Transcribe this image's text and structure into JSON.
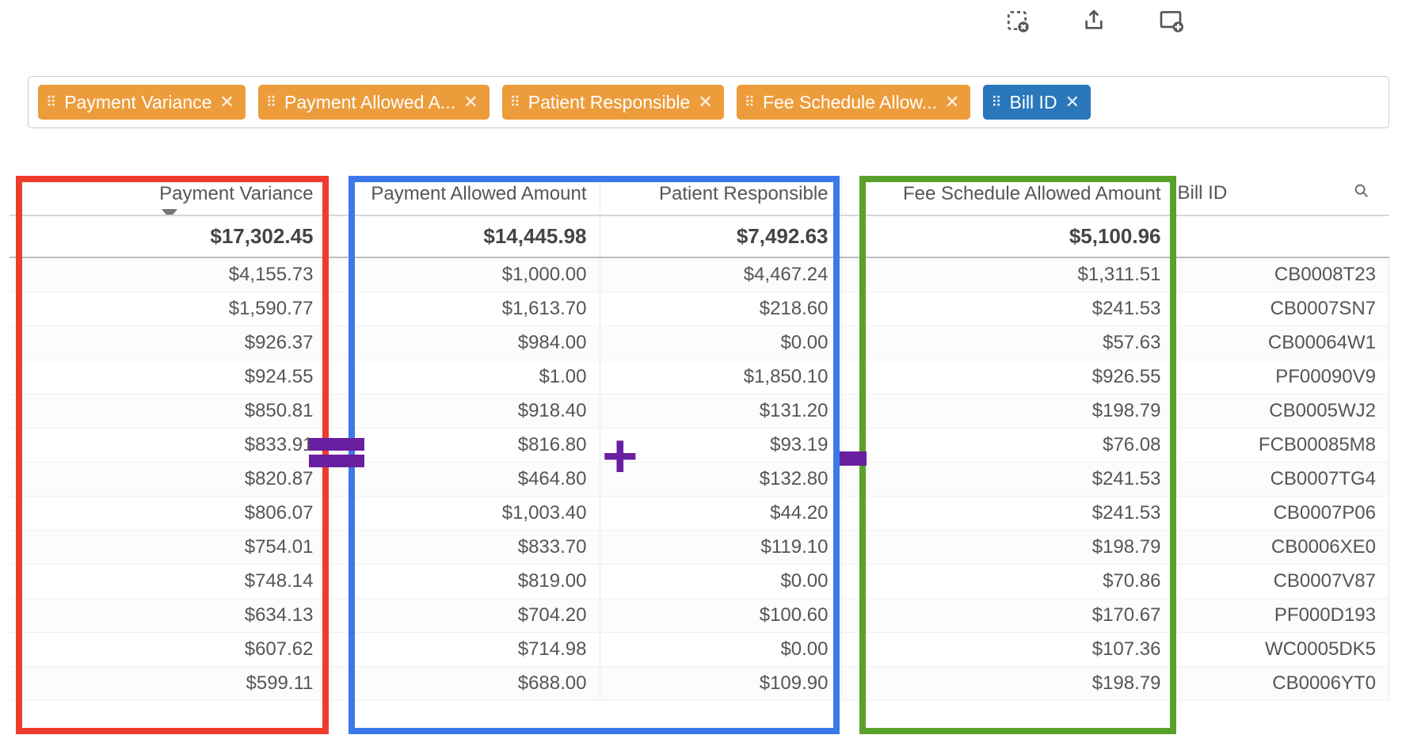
{
  "toolbar": {
    "icons": [
      "clear-selection-icon",
      "share-icon",
      "add-panel-icon"
    ]
  },
  "chips": [
    {
      "label": "Payment Variance",
      "color": "orange"
    },
    {
      "label": "Payment Allowed A...",
      "color": "orange"
    },
    {
      "label": "Patient Responsible",
      "color": "orange"
    },
    {
      "label": "Fee Schedule Allow...",
      "color": "orange"
    },
    {
      "label": "Bill ID",
      "color": "blue"
    }
  ],
  "columns": [
    {
      "header": "Payment Variance",
      "align": "right",
      "sort": "desc"
    },
    {
      "header": "Payment Allowed Amount",
      "align": "right"
    },
    {
      "header": "Patient Responsible",
      "align": "right"
    },
    {
      "header": "Fee Schedule Allowed Amount",
      "align": "right"
    },
    {
      "header": "Bill ID",
      "align": "left"
    }
  ],
  "totals": {
    "payment_variance": "$17,302.45",
    "payment_allowed": "$14,445.98",
    "patient_resp": "$7,492.63",
    "fee_sched": "$5,100.96",
    "bill_id": ""
  },
  "rows": [
    {
      "payment_variance": "$4,155.73",
      "payment_allowed": "$1,000.00",
      "patient_resp": "$4,467.24",
      "fee_sched": "$1,311.51",
      "bill_id": "CB0008T23"
    },
    {
      "payment_variance": "$1,590.77",
      "payment_allowed": "$1,613.70",
      "patient_resp": "$218.60",
      "fee_sched": "$241.53",
      "bill_id": "CB0007SN7"
    },
    {
      "payment_variance": "$926.37",
      "payment_allowed": "$984.00",
      "patient_resp": "$0.00",
      "fee_sched": "$57.63",
      "bill_id": "CB00064W1"
    },
    {
      "payment_variance": "$924.55",
      "payment_allowed": "$1.00",
      "patient_resp": "$1,850.10",
      "fee_sched": "$926.55",
      "bill_id": "PF00090V9"
    },
    {
      "payment_variance": "$850.81",
      "payment_allowed": "$918.40",
      "patient_resp": "$131.20",
      "fee_sched": "$198.79",
      "bill_id": "CB0005WJ2"
    },
    {
      "payment_variance": "$833.91",
      "payment_allowed": "$816.80",
      "patient_resp": "$93.19",
      "fee_sched": "$76.08",
      "bill_id": "FCB00085M8"
    },
    {
      "payment_variance": "$820.87",
      "payment_allowed": "$464.80",
      "patient_resp": "$132.80",
      "fee_sched": "$241.53",
      "bill_id": "CB0007TG4"
    },
    {
      "payment_variance": "$806.07",
      "payment_allowed": "$1,003.40",
      "patient_resp": "$44.20",
      "fee_sched": "$241.53",
      "bill_id": "CB0007P06"
    },
    {
      "payment_variance": "$754.01",
      "payment_allowed": "$833.70",
      "patient_resp": "$119.10",
      "fee_sched": "$198.79",
      "bill_id": "CB0006XE0"
    },
    {
      "payment_variance": "$748.14",
      "payment_allowed": "$819.00",
      "patient_resp": "$0.00",
      "fee_sched": "$70.86",
      "bill_id": "CB0007V87"
    },
    {
      "payment_variance": "$634.13",
      "payment_allowed": "$704.20",
      "patient_resp": "$100.60",
      "fee_sched": "$170.67",
      "bill_id": "PF000D193"
    },
    {
      "payment_variance": "$607.62",
      "payment_allowed": "$714.98",
      "patient_resp": "$0.00",
      "fee_sched": "$107.36",
      "bill_id": "WC0005DK5"
    },
    {
      "payment_variance": "$599.11",
      "payment_allowed": "$688.00",
      "patient_resp": "$109.90",
      "fee_sched": "$198.79",
      "bill_id": "CB0006YT0"
    }
  ],
  "annotations": {
    "equals": "=",
    "plus": "+",
    "minus": "−",
    "boxes": [
      "payment-variance",
      "payment-allowed+patient-responsible",
      "fee-schedule"
    ]
  },
  "colors": {
    "chip_orange": "#ed9c3b",
    "chip_blue": "#2a77bb",
    "box_red": "#ef3b2c",
    "box_blue": "#3b79e8",
    "box_green": "#5aa02c",
    "operator": "#6a1fa0"
  }
}
